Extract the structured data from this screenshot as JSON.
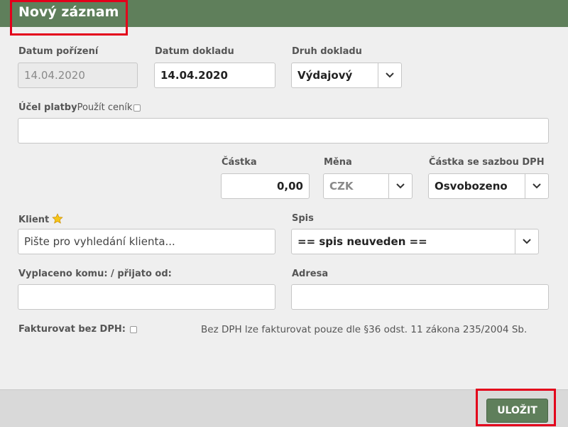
{
  "dialog": {
    "title": "Nový záznam"
  },
  "fields": {
    "datum_porizeni": {
      "label": "Datum pořízení",
      "value": "14.04.2020"
    },
    "datum_dokladu": {
      "label": "Datum dokladu",
      "value": "14.04.2020"
    },
    "druh_dokladu": {
      "label": "Druh dokladu",
      "value": "Výdajový"
    },
    "ucel_platby": {
      "label": "Účel platby",
      "option_label": "Použít ceník",
      "value": ""
    },
    "castka": {
      "label": "Částka",
      "value": "0,00"
    },
    "mena": {
      "label": "Měna",
      "value": "CZK"
    },
    "castka_dph": {
      "label": "Částka se sazbou DPH",
      "value": "Osvobozeno"
    },
    "klient": {
      "label": "Klient",
      "placeholder": "Pište pro vyhledání klienta..."
    },
    "spis": {
      "label": "Spis",
      "value": "== spis neuveden =="
    },
    "vyplaceno": {
      "label": "Vyplaceno komu: / přijato od:",
      "value": ""
    },
    "adresa": {
      "label": "Adresa",
      "value": ""
    },
    "fakturovat": {
      "label": "Fakturovat bez DPH:",
      "note": "Bez DPH lze fakturovat pouze dle §36 odst. 11 zákona 235/2004 Sb."
    }
  },
  "footer": {
    "save_label": "ULOŽIT"
  },
  "colors": {
    "header": "#5f7f5b",
    "highlight": "#e3001b",
    "star": "#f5c518"
  },
  "icons": {
    "dropdown": "chevron-down-icon",
    "favorite": "star-icon"
  }
}
